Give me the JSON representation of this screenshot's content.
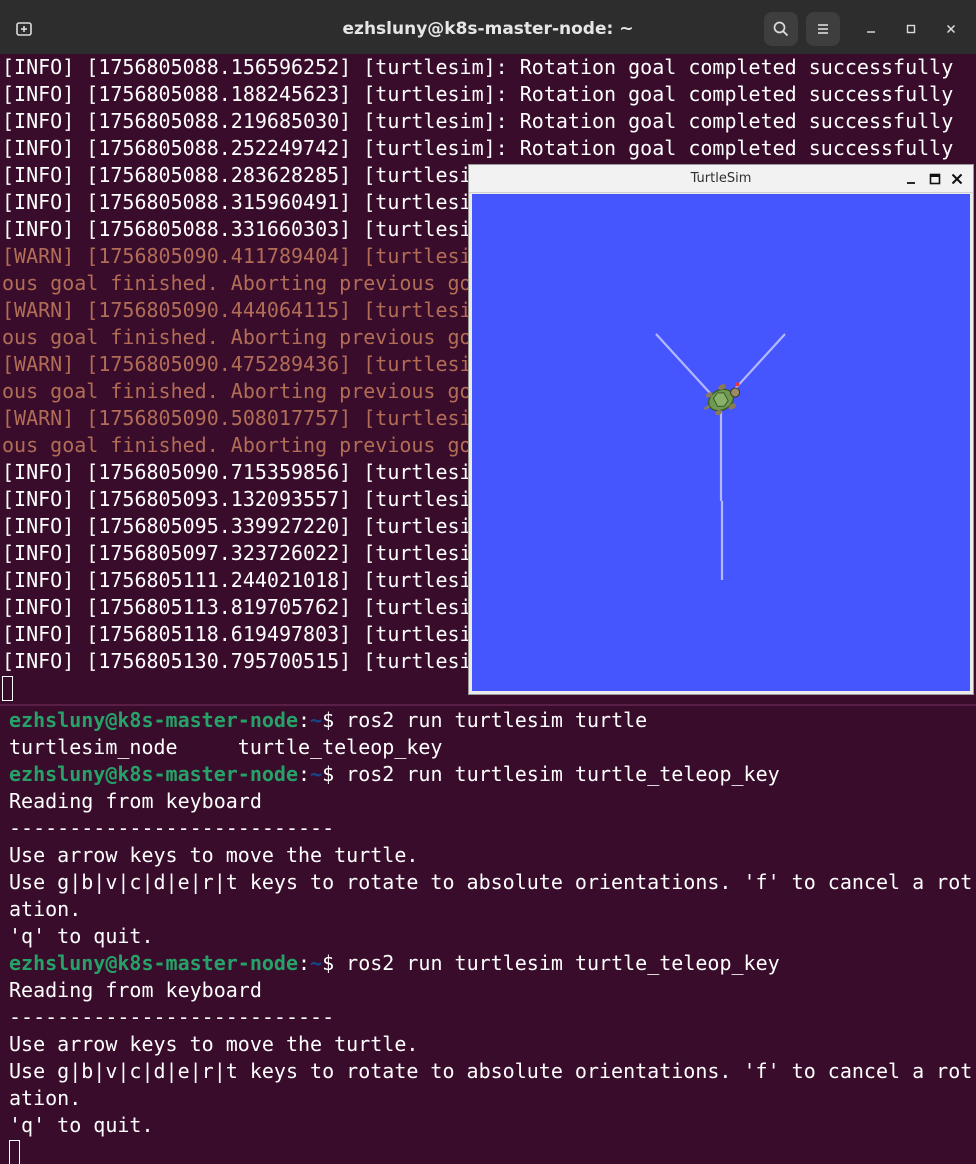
{
  "window": {
    "title": "ezhsluny@k8s-master-node: ~",
    "icons": [
      "new-tab-icon",
      "search-icon",
      "hamburger-menu-icon",
      "minimize-icon",
      "maximize-icon",
      "close-icon"
    ]
  },
  "top_log": {
    "lines": [
      {
        "level": "info",
        "text": "[INFO] [1756805088.156596252] [turtlesim]: Rotation goal completed successfully"
      },
      {
        "level": "info",
        "text": "[INFO] [1756805088.188245623] [turtlesim]: Rotation goal completed successfully"
      },
      {
        "level": "info",
        "text": "[INFO] [1756805088.219685030] [turtlesim]: Rotation goal completed successfully"
      },
      {
        "level": "info",
        "text": "[INFO] [1756805088.252249742] [turtlesim]: Rotation goal completed successfully"
      },
      {
        "level": "info",
        "text": "[INFO] [1756805088.283628285] [turtlesi"
      },
      {
        "level": "info",
        "text": "[INFO] [1756805088.315960491] [turtlesi"
      },
      {
        "level": "info",
        "text": "[INFO] [1756805088.331660303] [turtlesi"
      },
      {
        "level": "warn",
        "text": "[WARN] [1756805090.411789404] [turtlesi"
      },
      {
        "level": "warn",
        "text": "ous goal finished. Aborting previous go"
      },
      {
        "level": "warn",
        "text": "[WARN] [1756805090.444064115] [turtlesi"
      },
      {
        "level": "warn",
        "text": "ous goal finished. Aborting previous go"
      },
      {
        "level": "warn",
        "text": "[WARN] [1756805090.475289436] [turtlesi"
      },
      {
        "level": "warn",
        "text": "ous goal finished. Aborting previous go"
      },
      {
        "level": "warn",
        "text": "[WARN] [1756805090.508017757] [turtlesi"
      },
      {
        "level": "warn",
        "text": "ous goal finished. Aborting previous go"
      },
      {
        "level": "info",
        "text": "[INFO] [1756805090.715359856] [turtlesi"
      },
      {
        "level": "info",
        "text": "[INFO] [1756805093.132093557] [turtlesi"
      },
      {
        "level": "info",
        "text": "[INFO] [1756805095.339927220] [turtlesi"
      },
      {
        "level": "info",
        "text": "[INFO] [1756805097.323726022] [turtlesi"
      },
      {
        "level": "info",
        "text": "[INFO] [1756805111.244021018] [turtlesi"
      },
      {
        "level": "info",
        "text": "[INFO] [1756805113.819705762] [turtlesi"
      },
      {
        "level": "info",
        "text": "[INFO] [1756805118.619497803] [turtlesi"
      },
      {
        "level": "info",
        "text": "[INFO] [1756805130.795700515] [turtlesi"
      }
    ]
  },
  "bottom_terminal": {
    "prompt_user": "ezhsluny@k8s-master-node",
    "prompt_colon": ":",
    "prompt_path": "~",
    "prompt_symbol": "$ ",
    "lines": [
      {
        "type": "prompt",
        "cmd": "ros2 run turtlesim turtle"
      },
      {
        "type": "output",
        "text": "turtlesim_node     turtle_teleop_key"
      },
      {
        "type": "prompt",
        "cmd": "ros2 run turtlesim turtle_teleop_key"
      },
      {
        "type": "output",
        "text": "Reading from keyboard"
      },
      {
        "type": "output",
        "text": "---------------------------"
      },
      {
        "type": "output",
        "text": "Use arrow keys to move the turtle."
      },
      {
        "type": "output",
        "text": "Use g|b|v|c|d|e|r|t keys to rotate to absolute orientations. 'f' to cancel a rot"
      },
      {
        "type": "output",
        "text": "ation."
      },
      {
        "type": "output",
        "text": "'q' to quit."
      },
      {
        "type": "prompt",
        "cmd": "ros2 run turtlesim turtle_teleop_key"
      },
      {
        "type": "output",
        "text": "Reading from keyboard"
      },
      {
        "type": "output",
        "text": "---------------------------"
      },
      {
        "type": "output",
        "text": "Use arrow keys to move the turtle."
      },
      {
        "type": "output",
        "text": "Use g|b|v|c|d|e|r|t keys to rotate to absolute orientations. 'f' to cancel a rot"
      },
      {
        "type": "output",
        "text": "ation."
      },
      {
        "type": "output",
        "text": "'q' to quit."
      }
    ]
  },
  "turtlesim": {
    "title": "TurtleSim",
    "background_color": "#4556ff",
    "pen_color": "#b3b8ff",
    "icons": [
      "minimize-icon",
      "maximize-icon",
      "close-icon",
      "turtle-icon"
    ]
  },
  "colors": {
    "terminal_bg": "#380c2a",
    "warn_text": "#b26d57",
    "prompt_user": "#26a269",
    "prompt_path": "#12488b"
  }
}
